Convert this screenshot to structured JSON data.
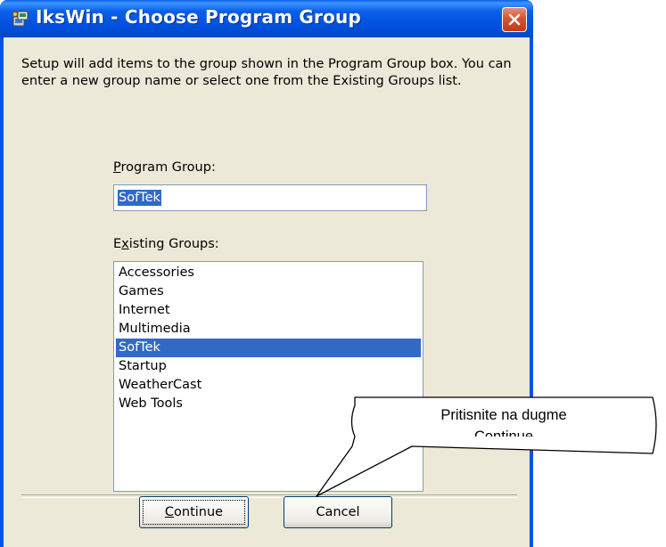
{
  "window": {
    "title": "IksWin - Choose Program Group",
    "accent_color": "#0054e3",
    "icon": "installer-icon"
  },
  "intro_text": "Setup will add items to the group shown in the Program Group box. You can enter a new group name or select one from the Existing Groups list.",
  "program_group": {
    "label_prefix": "",
    "label_accel": "P",
    "label_rest": "rogram Group:",
    "value": "SofTek"
  },
  "existing_groups": {
    "label_prefix": "E",
    "label_accel": "x",
    "label_rest": "isting Groups:",
    "items": [
      "Accessories",
      "Games",
      "Internet",
      "Multimedia",
      "SofTek",
      "Startup",
      "WeatherCast",
      "Web Tools"
    ],
    "selected": "SofTek"
  },
  "buttons": {
    "continue_accel": "C",
    "continue_rest": "ontinue",
    "cancel": "Cancel"
  },
  "callout": {
    "line1": "Pritisnite na dugme",
    "line2": "Continue"
  }
}
